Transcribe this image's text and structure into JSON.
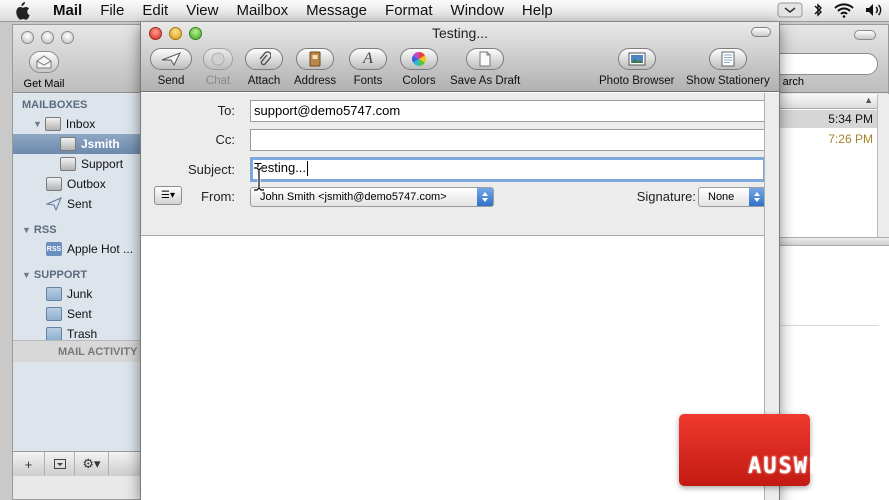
{
  "menubar": {
    "app": "Mail",
    "items": [
      "File",
      "Edit",
      "View",
      "Mailbox",
      "Message",
      "Format",
      "Window",
      "Help"
    ]
  },
  "main_window": {
    "get_mail_label": "Get Mail",
    "search_label": "arch"
  },
  "sidebar": {
    "mailboxes_header": "MAILBOXES",
    "inbox": "Inbox",
    "inbox_children": [
      "Jsmith",
      "Support"
    ],
    "outbox": "Outbox",
    "sent": "Sent",
    "rss_header": "RSS",
    "rss_feed": "Apple Hot ...",
    "rss_badge": "RSS",
    "support_header": "SUPPORT",
    "support_folders": [
      "Junk",
      "Sent",
      "Trash"
    ],
    "mail_activity": "MAIL ACTIVITY"
  },
  "message_list": {
    "times": [
      "5:34 PM",
      "7:26 PM"
    ],
    "time_colors": [
      "#111111",
      "#a3832b"
    ]
  },
  "compose": {
    "title": "Testing...",
    "toolbar": {
      "send": "Send",
      "chat": "Chat",
      "attach": "Attach",
      "address": "Address",
      "fonts": "Fonts",
      "colors": "Colors",
      "save_draft": "Save As Draft",
      "photo_browser": "Photo Browser",
      "show_stationery": "Show Stationery"
    },
    "to_label": "To:",
    "to_value": "support@demo5747.com",
    "cc_label": "Cc:",
    "cc_value": "",
    "subject_label": "Subject:",
    "subject_value": "Testing...",
    "from_label": "From:",
    "from_value": "John Smith <jsmith@demo5747.com>",
    "signature_label": "Signature:",
    "signature_value": "None"
  },
  "watermark": "AUSWEB",
  "colors": {
    "selection": "#7b95b8",
    "focus_ring": "#7ea7db",
    "popup_arrow": "#3b7bd0",
    "watermark": "#dd2a20"
  }
}
